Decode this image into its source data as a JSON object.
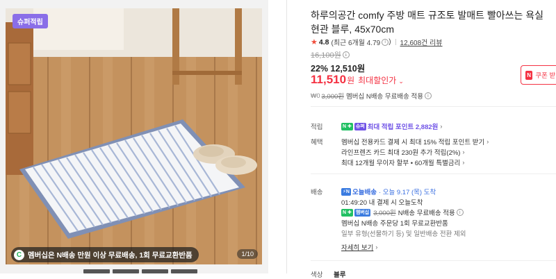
{
  "gallery": {
    "badge": "슈퍼적립",
    "promo_icon": "C",
    "promo_text": "멤버십은 N배송 만원 이상 무료배송, 1회 무료교환반품",
    "counter": "1/10"
  },
  "product": {
    "title": "하루의공간 comfy 주방 매트 규조토 발매트 빨아쓰는 욕실 현관 블루, 45x70cm",
    "rating": "4.8",
    "rating_recent": "(최근 6개월 4.79",
    "rating_recent_close": ")",
    "reviews": "12,608건 리뷰",
    "original_price": "16,100원",
    "discount": "22% 12,510원",
    "sale_amount": "11,510",
    "sale_unit": "원",
    "sale_max": "최대할인가",
    "coupon": "쿠폰 받기",
    "ship_fee_struck": "3,000원",
    "ship_fee_text": "멤버십 N배송 무료배송 적용"
  },
  "benefits": {
    "points_label": "적립",
    "points_text": "최대 적립 포인트 2,882원",
    "perks_label": "혜택",
    "perks": [
      "멤버십 전용카드 결제 시 최대 15% 적립 포인트 받기",
      "라인프렌즈 카드 최대 230원 추가 적립(2%)",
      "최대 12개월 무이자 할부 • 60개월 특별금리"
    ]
  },
  "delivery": {
    "label": "배송",
    "today_badge": "오늘배송",
    "today_text": "· 오늘 9.17 (목) 도착",
    "cutoff": "01:49:20  내 결제 시 오늘도착",
    "member_badge": "멤버십",
    "fee_struck": "3,000원",
    "fee_text": "N배송 무료배송 적용",
    "return_text": "멤버십 N배송 주문당 1회 무료교환반품",
    "exclusion": "일부 유형(선물하기 등) 및 일반배송 전환 제외",
    "more": "자세히 보기"
  },
  "bottom": {
    "label": "색상",
    "value": "블루"
  },
  "colors": {
    "accent_red": "#f43142",
    "npay_green": "#21c063",
    "point_purple": "#6f52e6",
    "badge_purple": "#8a6ee8"
  }
}
